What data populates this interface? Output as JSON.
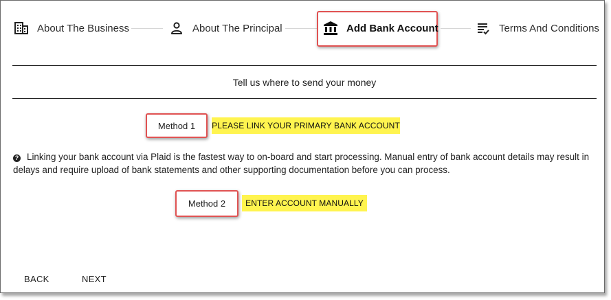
{
  "stepper": {
    "steps": [
      {
        "label": "About The Business",
        "icon": "building-icon",
        "active": false
      },
      {
        "label": "About The Principal",
        "icon": "person-icon",
        "active": false
      },
      {
        "label": "Add Bank Account",
        "icon": "bank-icon",
        "active": true
      },
      {
        "label": "Terms And Conditions",
        "icon": "checklist-icon",
        "active": false
      }
    ]
  },
  "subtitle": "Tell us where to send your money",
  "methods": {
    "method1": {
      "label": "Method 1",
      "button": "PLEASE LINK YOUR PRIMARY BANK ACCOUNT"
    },
    "method2": {
      "label": "Method 2",
      "button": "ENTER ACCOUNT MANUALLY"
    }
  },
  "info": {
    "icon": "question-circle-icon",
    "text": "Linking your bank account via Plaid is the fastest way to on-board and start processing. Manual entry of bank account details may result in delays and require upload of bank statements and other supporting documentation before you can process."
  },
  "nav": {
    "back": "BACK",
    "next": "NEXT"
  },
  "colors": {
    "highlight_border": "#e05252",
    "button_yellow": "#fff44f"
  }
}
